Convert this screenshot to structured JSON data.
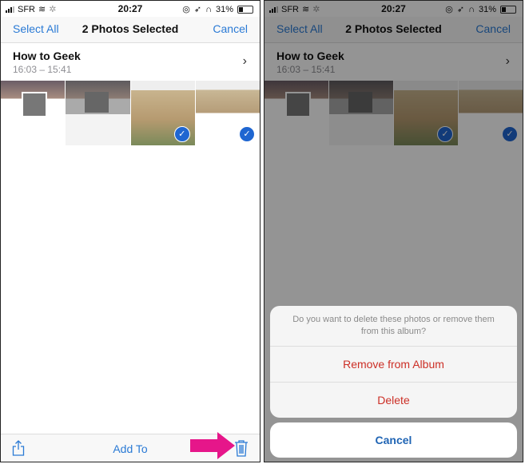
{
  "status_bar": {
    "carrier": "SFR",
    "time": "20:27",
    "battery": "31%"
  },
  "navbar": {
    "select_all": "Select All",
    "title": "2 Photos Selected",
    "cancel": "Cancel"
  },
  "album": {
    "name": "How to Geek",
    "range": "16:03 – 15:41"
  },
  "photos": [
    {
      "selected": false
    },
    {
      "selected": false
    },
    {
      "selected": true
    },
    {
      "selected": true
    }
  ],
  "toolbar": {
    "add_to": "Add To"
  },
  "action_sheet": {
    "message": "Do you want to delete these photos or remove them from this album?",
    "remove": "Remove from Album",
    "delete": "Delete",
    "cancel": "Cancel"
  },
  "colors": {
    "accent": "#2a7ad5",
    "destructive": "#cc2f26",
    "annotation_arrow": "#e6168a"
  }
}
